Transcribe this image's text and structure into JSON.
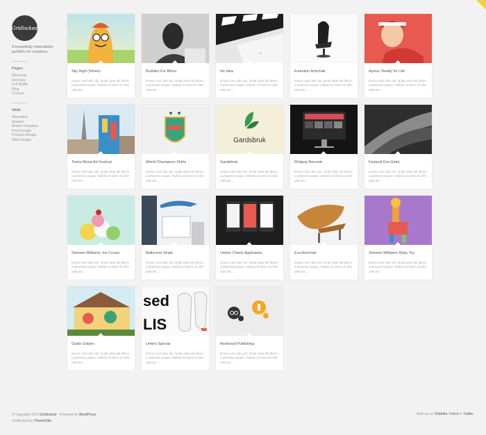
{
  "site": {
    "logo_text": "Gridlocked",
    "tagline": "A beautifully minimalistic portfolio for creatives."
  },
  "sidebar": {
    "pages_heading": "Pages",
    "pages": [
      "Elements",
      "Archives",
      "Full Width",
      "Blog",
      "Contact"
    ],
    "skills_heading": "Skills",
    "skills": [
      "Animation",
      "Artwork",
      "Motion Graphics",
      "Print Design",
      "Product Design",
      "Web Design"
    ]
  },
  "card_description": "Donec sed odio dui. Nulla vitae elit libero, a pharetra augue. Nullam id dolor id nibh ultricies ...",
  "projects": [
    {
      "title": "Sky High (Vimeo)"
    },
    {
      "title": "Buddies For Africa"
    },
    {
      "title": "No Idea"
    },
    {
      "title": "Evolution Armchair"
    },
    {
      "title": "Aprica: Ready for Life"
    },
    {
      "title": "Torino Mural Art Festival"
    },
    {
      "title": "World Champions Shirts"
    },
    {
      "title": "Gardsbruk"
    },
    {
      "title": "Rhdpop Records"
    },
    {
      "title": "Fauteuil Ora-Gami"
    },
    {
      "title": "Sherwin-Williams: Ice Cream"
    },
    {
      "title": "Bathroom Shark"
    },
    {
      "title": "Umbro Charts Application"
    },
    {
      "title": "Eva Armchair"
    },
    {
      "title": "Sherwin Williams: Baby Toy"
    },
    {
      "title": "Guido Gobino"
    },
    {
      "title": "Umbro Special"
    },
    {
      "title": "Redwood Publishing"
    }
  ],
  "thumb_text": {
    "gardsbruk": "Gardsbruk",
    "sed": "sed",
    "lis": "LIS"
  },
  "footer": {
    "copyright_prefix": "© Copyright 2013",
    "site_link": "Gridlocked",
    "powered_by": "· Powered by",
    "wordpress": "WordPress",
    "credit_prefix": "Gridlocked by",
    "credit_link": "ThemeZilla",
    "follow_prefix": "Stalk us on",
    "dribbble": "Dribbble",
    "sep_comma": ",",
    "forrst": "Forrst",
    "or": "or",
    "twitter": "Twitter"
  },
  "colors": {
    "accent_corner": "#f0d23a",
    "logo_bg": "#3a3a3a",
    "background": "#f2f2f2"
  }
}
